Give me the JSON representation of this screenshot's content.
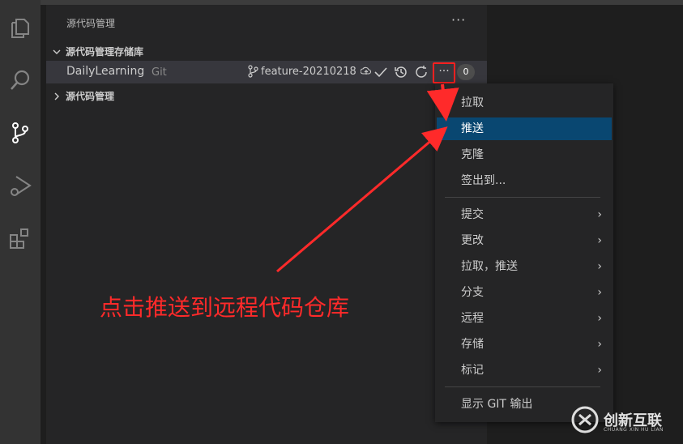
{
  "sidebar": {
    "title": "源代码管理",
    "more": "···",
    "repos_section": "源代码管理存储库",
    "repo": {
      "name": "DailyLearning",
      "type": "Git",
      "branch": "feature-20210218",
      "more": "···",
      "badge": "0"
    },
    "scm_section": "源代码管理"
  },
  "menu": {
    "items": [
      {
        "label": "拉取"
      },
      {
        "label": "推送"
      },
      {
        "label": "克隆"
      },
      {
        "label": "签出到..."
      },
      {
        "label": "提交"
      },
      {
        "label": "更改"
      },
      {
        "label": "拉取，推送"
      },
      {
        "label": "分支"
      },
      {
        "label": "远程"
      },
      {
        "label": "存储"
      },
      {
        "label": "标记"
      },
      {
        "label": "显示 GIT 输出"
      }
    ],
    "submenu_arrow": "›"
  },
  "annotation": {
    "text": "点击推送到远程代码仓库"
  },
  "watermark": {
    "brand": "创新互联",
    "sub": "CHUANG XIN HU LIAN"
  },
  "colors": {
    "highlight": "#094771",
    "annotation": "#ff2a2a"
  }
}
